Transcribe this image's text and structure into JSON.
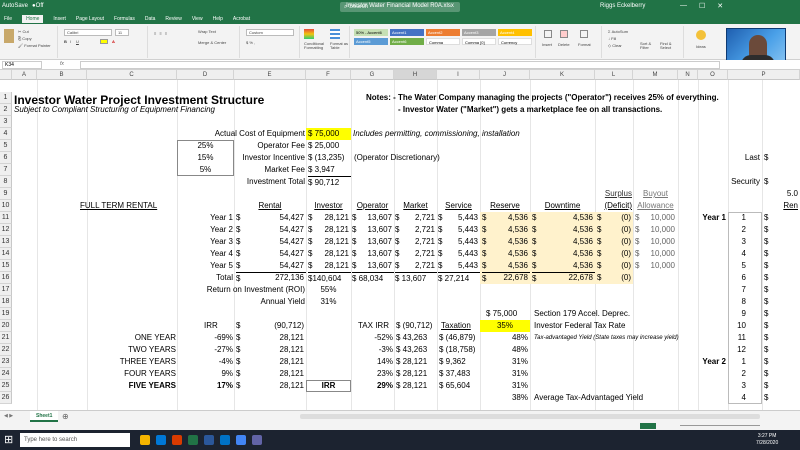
{
  "titlebar": {
    "autosave": "AutoSave",
    "filename": "Investor Water Financial Model R0A.xlsx",
    "search": "Search",
    "user": "Riggs Eckelberry"
  },
  "menu": [
    "File",
    "Home",
    "Insert",
    "Page Layout",
    "Formulas",
    "Data",
    "Review",
    "View",
    "Help",
    "Acrobat"
  ],
  "ribbon": {
    "font": "Calibri",
    "size": "11",
    "number_format": "Custom",
    "wrap": "Wrap Text",
    "merge": "Merge & Center",
    "styles": [
      "50% - Accent6",
      "Accent1",
      "Accent2",
      "Accent3",
      "Accent4",
      "Accent5",
      "Accent6",
      "Comma",
      "Comma [0]",
      "Currency"
    ],
    "cond_fmt": "Conditional Formatting",
    "fmt_table": "Format as Table",
    "insert": "Insert",
    "delete": "Delete",
    "format": "Format",
    "autosum": "AutoSum",
    "fill": "Fill",
    "clear": "Clear",
    "sort": "Sort & Filter",
    "find": "Find & Select",
    "ideas": "Ideas"
  },
  "namebox": "K34",
  "fx_icon": "fx",
  "columns": [
    "A",
    "B",
    "C",
    "D",
    "E",
    "F",
    "G",
    "H",
    "I",
    "J",
    "K",
    "L",
    "M",
    "N",
    "O",
    "P"
  ],
  "rows": [
    "1",
    "2",
    "3",
    "4",
    "5",
    "6",
    "7",
    "8",
    "9",
    "10",
    "11",
    "12",
    "13",
    "14",
    "15",
    "16",
    "17",
    "18",
    "19",
    "20",
    "21",
    "22",
    "23",
    "24",
    "25",
    "26"
  ],
  "sheet": {
    "title": "Investor Water Project Investment Structure",
    "subtitle": "Subject to Compliant Structuring of Equipment Financing",
    "notes1": "Notes: - The Water Company managing the projects (\"Operator\") receives 25% of everything.",
    "notes2": "- Investor Water (\"Market\") gets a marketplace fee on all transactions.",
    "r4": {
      "label": "Actual Cost of Equipment",
      "val": "$  75,000",
      "note": "Includes permitting, commissioning, installation"
    },
    "r5": {
      "pct": "25%",
      "label": "Operator Fee",
      "val": "$  25,000"
    },
    "r6": {
      "pct": "15%",
      "label": "Investor Incentive",
      "val": "$ (13,235)",
      "note": "(Operator Discretionary)",
      "right_label": "Last",
      "right_val": "$"
    },
    "r7": {
      "pct": "5%",
      "label": "Market Fee",
      "val": "$    3,947"
    },
    "r8": {
      "label": "Investment Total",
      "val": "$  90,712",
      "right_label": "Security",
      "right_val": "$"
    },
    "r9": {
      "surplus": "Surplus",
      "buyout": "Buyout",
      "p": "5.0"
    },
    "r10": {
      "full": "FULL TERM RENTAL",
      "rental": "Rental",
      "investor": "Investor",
      "operator": "Operator",
      "market": "Market",
      "service": "Service",
      "reserve": "Reserve",
      "downtime": "Downtime",
      "deficit": "(Deficit)",
      "allowance": "Allowance",
      "ren": "Ren"
    },
    "years": [
      {
        "y": "Year 1",
        "rental": "54,427",
        "inv": "28,121",
        "op": "13,607",
        "mk": "2,721",
        "sv": "5,443",
        "rs": "4,536",
        "dt": "4,536",
        "sd": "(0)",
        "bo": "10,000",
        "o": "Year 1",
        "p": "1"
      },
      {
        "y": "Year 2",
        "rental": "54,427",
        "inv": "28,121",
        "op": "13,607",
        "mk": "2,721",
        "sv": "5,443",
        "rs": "4,536",
        "dt": "4,536",
        "sd": "(0)",
        "bo": "10,000",
        "o": "",
        "p": "2"
      },
      {
        "y": "Year 3",
        "rental": "54,427",
        "inv": "28,121",
        "op": "13,607",
        "mk": "2,721",
        "sv": "5,443",
        "rs": "4,536",
        "dt": "4,536",
        "sd": "(0)",
        "bo": "10,000",
        "o": "",
        "p": "3"
      },
      {
        "y": "Year 4",
        "rental": "54,427",
        "inv": "28,121",
        "op": "13,607",
        "mk": "2,721",
        "sv": "5,443",
        "rs": "4,536",
        "dt": "4,536",
        "sd": "(0)",
        "bo": "10,000",
        "o": "",
        "p": "4"
      },
      {
        "y": "Year 5",
        "rental": "54,427",
        "inv": "28,121",
        "op": "13,607",
        "mk": "2,721",
        "sv": "5,443",
        "rs": "4,536",
        "dt": "4,536",
        "sd": "(0)",
        "bo": "10,000",
        "o": "",
        "p": "5"
      }
    ],
    "r16": {
      "label": "Total",
      "rental": "272,136",
      "inv": "$140,604",
      "op": "$  68,034",
      "mk": "$  13,607",
      "sv": "$  27,214",
      "rs": "22,678",
      "dt": "22,678",
      "sd": "(0)",
      "p": "6"
    },
    "r17": {
      "label": "Return on Investment (ROI)",
      "val": "55%",
      "p": "7"
    },
    "r18": {
      "label": "Annual Yield",
      "val": "31%",
      "p": "8"
    },
    "r19": {
      "val": "$   75,000",
      "label": "Section 179 Accel. Deprec.",
      "p": "9"
    },
    "r20": {
      "irr": "IRR",
      "e": "(90,712)",
      "taxirr": "TAX IRR",
      "h": "$ (90,712)",
      "tax": "Taxation",
      "pct": "35%",
      "label": "Investor Federal Tax Rate",
      "p": "10"
    },
    "irr_rows": [
      {
        "lbl": "ONE YEAR",
        "d": "-69%",
        "e": "28,121",
        "g": "-52%",
        "h": "$  43,263",
        "i": "$ (46,879)",
        "j": "48%",
        "note": "Tax-advantaged Yield (State taxes may increase yield)",
        "o": "",
        "p": "11"
      },
      {
        "lbl": "TWO YEARS",
        "d": "-27%",
        "e": "28,121",
        "g": "-3%",
        "h": "$  43,263",
        "i": "$ (18,758)",
        "j": "48%",
        "note": "",
        "o": "",
        "p": "12"
      },
      {
        "lbl": "THREE YEARS",
        "d": "-4%",
        "e": "28,121",
        "g": "14%",
        "h": "$  28,121",
        "i": "$    9,362",
        "j": "31%",
        "note": "",
        "o": "Year 2",
        "p": "1"
      },
      {
        "lbl": "FOUR YEARS",
        "d": "9%",
        "e": "28,121",
        "g": "23%",
        "h": "$  28,121",
        "i": "$  37,483",
        "j": "31%",
        "note": "",
        "o": "",
        "p": "2"
      },
      {
        "lbl": "FIVE YEARS",
        "d": "17%",
        "e": "28,121",
        "f": "IRR",
        "g": "29%",
        "h": "$  28,121",
        "i": "$  65,604",
        "j": "31%",
        "note": "",
        "o": "",
        "p": "3"
      }
    ],
    "r26": {
      "j": "38%",
      "label": "Average Tax-Advantaged Yield",
      "p": "4"
    }
  },
  "tabs": {
    "sheet1": "Sheet1"
  },
  "taskbar": {
    "search": "Type here to search",
    "time": "3:27 PM",
    "date": "7/28/2020"
  },
  "colors": {
    "excel_green": "#217346",
    "reserve_fill": "#fff2cc",
    "yellow": "#ffff00"
  }
}
